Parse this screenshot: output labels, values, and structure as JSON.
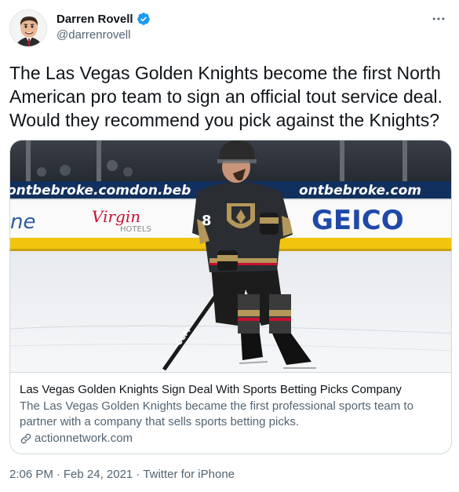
{
  "author": {
    "display_name": "Darren Rovell",
    "handle": "@darrenrovell",
    "verified": true
  },
  "tweet": {
    "text": "The Las Vegas Golden Knights become the first North American pro team to sign an official tout service deal. Would they recommend you pick against the Knights?"
  },
  "card": {
    "image_signage": {
      "top_banner_left": "ontbebroke.com",
      "top_banner_mid": "don.beb",
      "top_banner_right": "ontbebroke.com",
      "board_left": "ne",
      "virgin_brand": "Virgin",
      "virgin_sub": "HOTELS",
      "geico": "GEICO",
      "jersey_number": "8",
      "stick_brand": "CCM"
    },
    "title": "Las Vegas Golden Knights Sign Deal With Sports Betting Picks Company",
    "description": "The Las Vegas Golden Knights became the first professional sports team to partner with a company that sells sports betting picks.",
    "domain": "actionnetwork.com"
  },
  "meta": {
    "time": "2:06 PM",
    "date": "Feb 24, 2021",
    "source": "Twitter for iPhone",
    "separator": "·"
  },
  "colors": {
    "verified_blue": "#1d9bf0",
    "secondary_text": "#536471",
    "border": "#cfd9de",
    "geico_blue": "#1f48a8",
    "virgin_red": "#c8102e",
    "knights_gold": "#b4975a"
  },
  "icons": {
    "verified": "verified-badge-icon",
    "more": "more-dots-icon",
    "link": "link-icon"
  }
}
